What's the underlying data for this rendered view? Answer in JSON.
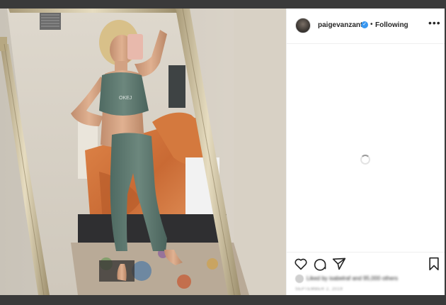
{
  "post": {
    "username": "paigevanzant",
    "separator": "•",
    "follow_status": "Following",
    "more_label": "•••",
    "verified_glyph": "✓",
    "likes_text": "Liked by isabelraf and 95,000 others",
    "timestamp": "SEPTEMBER 2, 2019"
  },
  "photo": {
    "top_text": "OKEJ"
  },
  "icons": {
    "like": "heart-icon",
    "comment": "comment-icon",
    "share": "share-icon",
    "save": "bookmark-icon",
    "more": "more-options-icon"
  },
  "colors": {
    "verified": "#3897f0",
    "text": "#262626",
    "muted": "#8e8e8e",
    "divider": "#efefef",
    "backdrop": "#3a3a3a"
  }
}
